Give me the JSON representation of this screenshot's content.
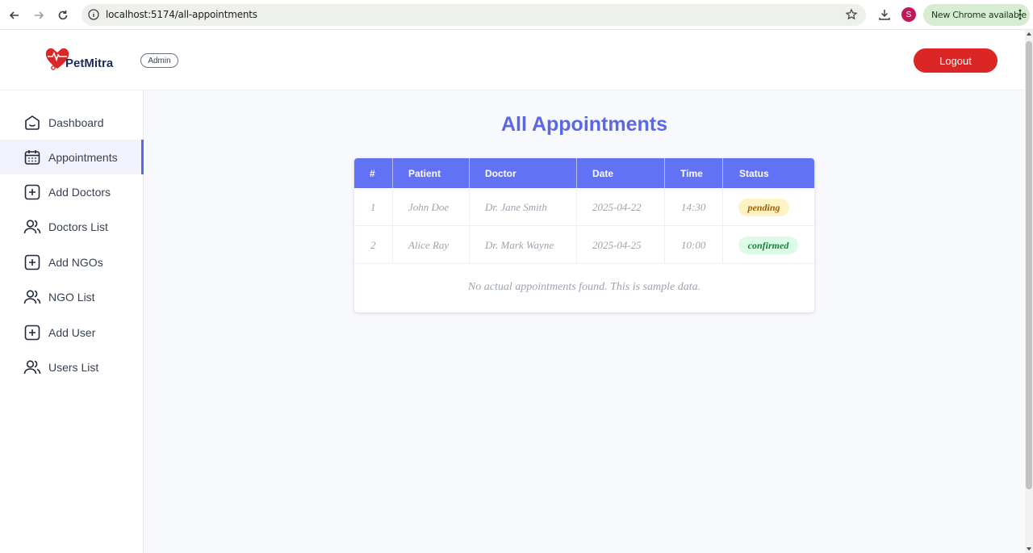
{
  "browser": {
    "url": "localhost:5174/all-appointments",
    "profile_initial": "S",
    "update_label": "New Chrome available"
  },
  "header": {
    "brand": "PetMitra",
    "role_badge": "Admin",
    "logout_label": "Logout"
  },
  "sidebar": {
    "items": [
      {
        "label": "Dashboard",
        "icon": "home-icon"
      },
      {
        "label": "Appointments",
        "icon": "calendar-icon",
        "active": true
      },
      {
        "label": "Add Doctors",
        "icon": "plus-square-icon"
      },
      {
        "label": "Doctors List",
        "icon": "users-icon"
      },
      {
        "label": "Add NGOs",
        "icon": "plus-square-icon"
      },
      {
        "label": "NGO List",
        "icon": "users-icon"
      },
      {
        "label": "Add User",
        "icon": "plus-square-icon"
      },
      {
        "label": "Users List",
        "icon": "users-icon"
      }
    ]
  },
  "main": {
    "title": "All Appointments",
    "table": {
      "headers": [
        "#",
        "Patient",
        "Doctor",
        "Date",
        "Time",
        "Status"
      ],
      "rows": [
        {
          "num": "1",
          "patient": "John Doe",
          "doctor": "Dr. Jane Smith",
          "date": "2025-04-22",
          "time": "14:30",
          "status": "pending"
        },
        {
          "num": "2",
          "patient": "Alice Ray",
          "doctor": "Dr. Mark Wayne",
          "date": "2025-04-25",
          "time": "10:00",
          "status": "confirmed"
        }
      ]
    },
    "note": "No actual appointments found. This is sample data."
  },
  "colors": {
    "accent": "#5a67e8",
    "table_header": "#6272f5",
    "logout": "#dc2626",
    "pending_bg": "#fdf3c4",
    "confirmed_bg": "#dcfce7"
  }
}
